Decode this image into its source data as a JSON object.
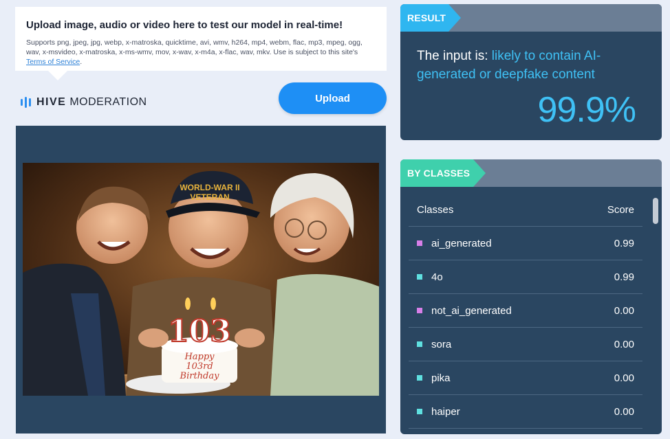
{
  "upload": {
    "title": "Upload image, audio or video here to test our model in real-time!",
    "description": "Supports png, jpeg, jpg, webp, x-matroska, quicktime, avi, wmv, h264, mp4, webm, flac, mp3, mpeg, ogg, wav, x-msvideo, x-matroska, x-ms-wmv, mov, x-wav, x-m4a, x-flac, wav, mkv. Use is subject to this site's",
    "terms_link": "Terms of Service",
    "terms_suffix": ".",
    "button_label": "Upload"
  },
  "brand": {
    "name_bold": "HIVE",
    "name_light": "MODERATION",
    "logo_color": "#2b8ef0"
  },
  "preview": {
    "cake_number": "103",
    "cake_line1": "Happy",
    "cake_line2": "103rd",
    "cake_line3": "Birthday",
    "cap_line1": "WORLD-WAR II",
    "cap_line2": "VETERAN"
  },
  "result": {
    "tag": "RESULT",
    "prefix": "The input is:",
    "verdict": "likely to contain AI-generated or deepfake content",
    "percentage": "99.9%"
  },
  "classes": {
    "tag": "BY CLASSES",
    "col_class": "Classes",
    "col_score": "Score",
    "rows": [
      {
        "name": "ai_generated",
        "score": "0.99",
        "color": "#d77fe8"
      },
      {
        "name": "4o",
        "score": "0.99",
        "color": "#5fe0e0"
      },
      {
        "name": "not_ai_generated",
        "score": "0.00",
        "color": "#d77fe8"
      },
      {
        "name": "sora",
        "score": "0.00",
        "color": "#5fe0e0"
      },
      {
        "name": "pika",
        "score": "0.00",
        "color": "#5fe0e0"
      },
      {
        "name": "haiper",
        "score": "0.00",
        "color": "#5fe0e0"
      }
    ]
  },
  "colors": {
    "accent": "#1e8ff5",
    "panel": "#2a4661",
    "result_highlight": "#3fc1f5",
    "tag_blue": "#2fb6f0",
    "tag_green": "#3fd0ac"
  }
}
